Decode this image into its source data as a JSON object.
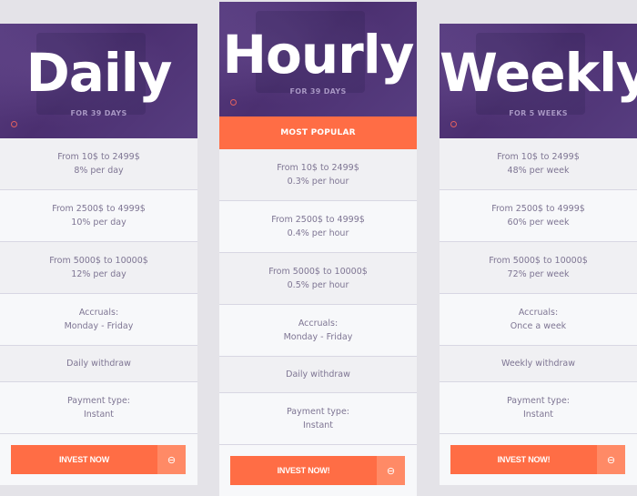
{
  "plans": [
    {
      "title": "Daily",
      "duration": "FOR 39 DAYS",
      "popular_label": null,
      "tiers": [
        {
          "range": "From 10$ to 2499$",
          "rate": "8% per day"
        },
        {
          "range": "From 2500$ to 4999$",
          "rate": "10% per day"
        },
        {
          "range": "From 5000$ to 10000$",
          "rate": "12% per day"
        }
      ],
      "accruals_label": "Accruals:",
      "accruals_value": "Monday - Friday",
      "withdraw": "Daily withdraw",
      "payment_label": "Payment type:",
      "payment_value": "Instant",
      "button_label": "INVEST NOW",
      "button_icon": "arrow-circle-icon"
    },
    {
      "title": "Hourly",
      "duration": "FOR 39 DAYS",
      "popular_label": "MOST POPULAR",
      "tiers": [
        {
          "range": "From 10$ to 2499$",
          "rate": "0.3% per hour"
        },
        {
          "range": "From 2500$ to 4999$",
          "rate": "0.4% per hour"
        },
        {
          "range": "From 5000$ to 10000$",
          "rate": "0.5% per hour"
        }
      ],
      "accruals_label": "Accruals:",
      "accruals_value": "Monday - Friday",
      "withdraw": "Daily withdraw",
      "payment_label": "Payment type:",
      "payment_value": "Instant",
      "button_label": "INVEST NOW!",
      "button_icon": "arrow-circle-icon"
    },
    {
      "title": "Weekly",
      "duration": "FOR 5 WEEKS",
      "popular_label": null,
      "tiers": [
        {
          "range": "From 10$ to 2499$",
          "rate": "48% per week"
        },
        {
          "range": "From 2500$ to 4999$",
          "rate": "60% per week"
        },
        {
          "range": "From 5000$ to 10000$",
          "rate": "72% per week"
        }
      ],
      "accruals_label": "Accruals:",
      "accruals_value": "Once a week",
      "withdraw": "Weekly withdraw",
      "payment_label": "Payment type:",
      "payment_value": "Instant",
      "button_label": "INVEST NOW!",
      "button_icon": "arrow-circle-icon"
    }
  ],
  "colors": {
    "accent": "#ff6d45",
    "accent_light": "#ff8a66",
    "banner_purple": "#4b2f70",
    "text_muted": "#7e7593",
    "background": "#e4e3e8"
  }
}
